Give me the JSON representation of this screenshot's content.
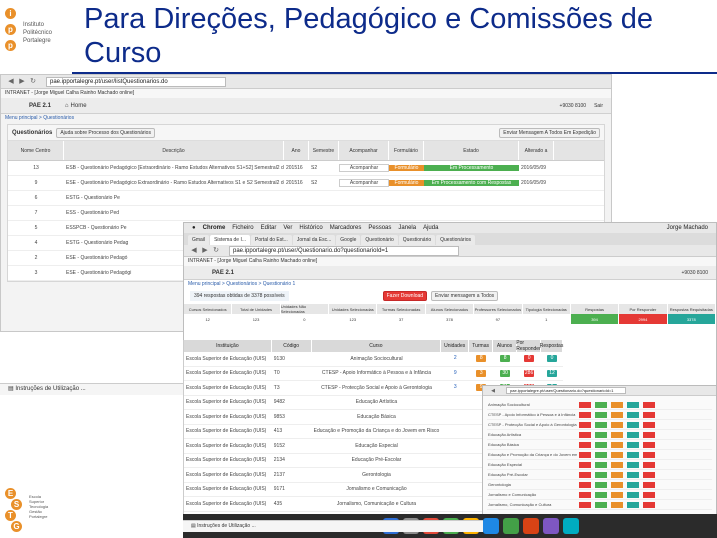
{
  "slide": {
    "title": "Para Direções, Pedagógico e Comissões de Curso"
  },
  "branding": {
    "ipp_lines": [
      "Instituto",
      "Politécnico",
      "Portalegre"
    ],
    "estgp_lines": [
      "Escola",
      "Superior",
      "Tecnologia",
      "Gestão",
      "Portalegre"
    ]
  },
  "window1": {
    "url": "pae.ipportalegre.pt/user/listQuestionarios.do",
    "user_line": "INTRANET - [Jorge Miguel Calha Rainho Machado online]",
    "app_label": "PAE 2.1",
    "home_label": "Home",
    "phone": "+9030 8100",
    "logout": "Sair",
    "breadcrumb": "Menu principal > Questionários",
    "panel_title": "Questionários",
    "new_button": "Ajuda sobre Processo dos Questionários",
    "right_button": "Enviar Mensagem A Todos Em Expedição",
    "columns": [
      "Nome Centro",
      "Descrição",
      "Ano",
      "Semestre",
      "Acompanhar",
      "Formulário",
      "Estado",
      "Alterado a"
    ],
    "rows": [
      {
        "num": "13",
        "desc": "ESB - Questionário Pedagógico [Extraordinário - Ramo Estudos Alternativos S1+S2] Semestral2 de 2015/16",
        "ano": "201516",
        "sem": "S2",
        "acomp": "Acompanhar",
        "form": "Formulário",
        "estado": "Em Processamento",
        "data": "2016/05/09"
      },
      {
        "num": "9",
        "desc": "ESE - Questionário Pedagógico Extraordinário - Ramo Estudos Alternativos S1 e S2 Semestral2 de 2015/16",
        "ano": "201516",
        "sem": "S2",
        "acomp": "Acompanhar",
        "form": "Formulário",
        "estado": "Em Processamento com Respostas",
        "data": "2016/05/09"
      },
      {
        "num": "6",
        "desc": "ESTG - Questionário Pe",
        "ano": "",
        "sem": "",
        "acomp": "",
        "form": "",
        "estado": "",
        "data": ""
      },
      {
        "num": "7",
        "desc": "ESS - Questionário Ped",
        "ano": "",
        "sem": "",
        "acomp": "",
        "form": "",
        "estado": "",
        "data": ""
      },
      {
        "num": "5",
        "desc": "ESSPCB - Questionário Pe",
        "ano": "",
        "sem": "",
        "acomp": "",
        "form": "",
        "estado": "",
        "data": ""
      },
      {
        "num": "4",
        "desc": "ESTG - Questionário Pedag",
        "ano": "",
        "sem": "",
        "acomp": "",
        "form": "",
        "estado": "",
        "data": ""
      },
      {
        "num": "2",
        "desc": "ESE - Questionário Pedagó",
        "ano": "",
        "sem": "",
        "acomp": "",
        "form": "",
        "estado": "",
        "data": ""
      },
      {
        "num": "3",
        "desc": "ESE - Questionário Pedagógi",
        "ano": "",
        "sem": "",
        "acomp": "",
        "form": "",
        "estado": "",
        "data": ""
      }
    ]
  },
  "window2": {
    "menu": [
      "Chrome",
      "Ficheiro",
      "Editar",
      "Ver",
      "Histórico",
      "Marcadores",
      "Pessoas",
      "Janela",
      "Ajuda"
    ],
    "clock": "Jorge Machado",
    "tabs": [
      "Gmail",
      "Sistema de I...",
      "Portal do Est...",
      "Jornal da Esc...",
      "Google",
      "Questionário",
      "Questionário",
      "Questionários"
    ],
    "url": "pae.ipportalegre.pt/user/Questionario.do?questionarioId=1",
    "user_line": "INTRANET - [Jorge Miguel Calha Rainho Machado online]",
    "app_label": "PAE 2.1",
    "phone": "+9030 8100",
    "breadcrumb": "Menu principal > Questionários > Questionário 1",
    "responses": "394 respostas obtidas de 3378 possíveis",
    "btn_primary": "Fazer Download",
    "btn_secondary": "Enviar mensagem a Todos",
    "stats_head": [
      "Cursos Selecionados",
      "Total de Unidades",
      "Unidades Não Selecionadas",
      "Unidades Selecionadas",
      "Turmas Selecionadas",
      "Alunos Selecionados",
      "Professores Selecionados",
      "Tipologia Selecionadas",
      "Respostas",
      "Por Responder",
      "Respostas Requisitadas"
    ],
    "stats_values": [
      "12",
      "123",
      "0",
      "123",
      "37",
      "378",
      "97",
      "1",
      "394",
      "2994",
      "3378"
    ],
    "table_head": [
      "Instituição",
      "Código",
      "Curso",
      "Unidades",
      "Turmas",
      "Alunos",
      "Por Responder",
      "Respostas"
    ],
    "rows": [
      {
        "inst": "Escola Superior de Educação (IUIS)",
        "cod": "9130",
        "curso": "Animação Sociocultural",
        "u": "2",
        "t": "8",
        "a": "8",
        "p": "0",
        "r": "0"
      },
      {
        "inst": "Escola Superior de Educação (IUIS)",
        "cod": "T0",
        "curso": "CTESP - Apoio Informático à Pessoa e à Infância",
        "u": "9",
        "t": "3",
        "a": "30",
        "p": "286",
        "r": "12"
      },
      {
        "inst": "Escola Superior de Educação (IUIS)",
        "cod": "T3",
        "curso": "CTESP - Protecção Social e Apoio à Gerontologia",
        "u": "3",
        "t": "9",
        "a": "21",
        "p": "180",
        "r": "6"
      },
      {
        "inst": "Escola Superior de Educação (IUIS)",
        "cod": "9482",
        "curso": "Educação Artística",
        "u": "",
        "t": "",
        "a": "",
        "p": "",
        "r": ""
      },
      {
        "inst": "Escola Superior de Educação (IUIS)",
        "cod": "9853",
        "curso": "Educação Básica",
        "u": "",
        "t": "",
        "a": "",
        "p": "",
        "r": ""
      },
      {
        "inst": "Escola Superior de Educação (IUIS)",
        "cod": "413",
        "curso": "Educação e Promoção da Criança e do Jovem em Risco",
        "u": "",
        "t": "",
        "a": "",
        "p": "",
        "r": ""
      },
      {
        "inst": "Escola Superior de Educação (IUIS)",
        "cod": "9152",
        "curso": "Educação Especial",
        "u": "",
        "t": "",
        "a": "",
        "p": "",
        "r": ""
      },
      {
        "inst": "Escola Superior de Educação (IUIS)",
        "cod": "2134",
        "curso": "Educação Pré-Escolar",
        "u": "",
        "t": "",
        "a": "",
        "p": "",
        "r": ""
      },
      {
        "inst": "Escola Superior de Educação (IUIS)",
        "cod": "2137",
        "curso": "Gerontologia",
        "u": "",
        "t": "",
        "a": "",
        "p": "",
        "r": ""
      },
      {
        "inst": "Escola Superior de Educação (IUIS)",
        "cod": "9171",
        "curso": "Jornalismo e Comunicação",
        "u": "",
        "t": "",
        "a": "",
        "p": "",
        "r": ""
      },
      {
        "inst": "Escola Superior de Educação (IUIS)",
        "cod": "435",
        "curso": "Jornalismo, Comunicação e Cultura",
        "u": "",
        "t": "",
        "a": "",
        "p": "",
        "r": ""
      }
    ]
  },
  "taskbar1": "Instruções de Utilização ...",
  "taskbar2": "Instruções de Utilização ...",
  "colors": {
    "title_blue": "#0d2b8a",
    "orange": "#e9902a",
    "green": "#4caf50",
    "red": "#e53935",
    "teal": "#26a69a"
  }
}
